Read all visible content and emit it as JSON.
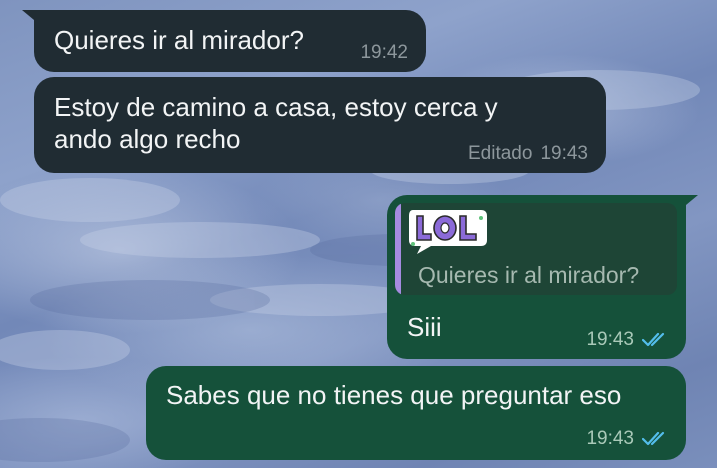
{
  "colors": {
    "incoming_bubble": "#202c33",
    "outgoing_bubble": "#15513a",
    "quote_bar": "#a58be0",
    "read_ticks": "#53bdeb"
  },
  "messages": [
    {
      "direction": "incoming",
      "text": "Quieres ir al mirador?",
      "time": "19:42",
      "edited": ""
    },
    {
      "direction": "incoming",
      "text": "Estoy de camino a casa, estoy cerca y\nando algo recho",
      "time": "19:43",
      "edited": "Editado"
    },
    {
      "direction": "outgoing",
      "reply_to": {
        "sticker": "LOL",
        "text": "Quieres ir al mirador?"
      },
      "text": "Siii",
      "time": "19:43",
      "status_icon": "double-check-read-icon"
    },
    {
      "direction": "outgoing",
      "text": "Sabes que no tienes que preguntar eso",
      "time": "19:43",
      "status_icon": "double-check-read-icon"
    }
  ]
}
